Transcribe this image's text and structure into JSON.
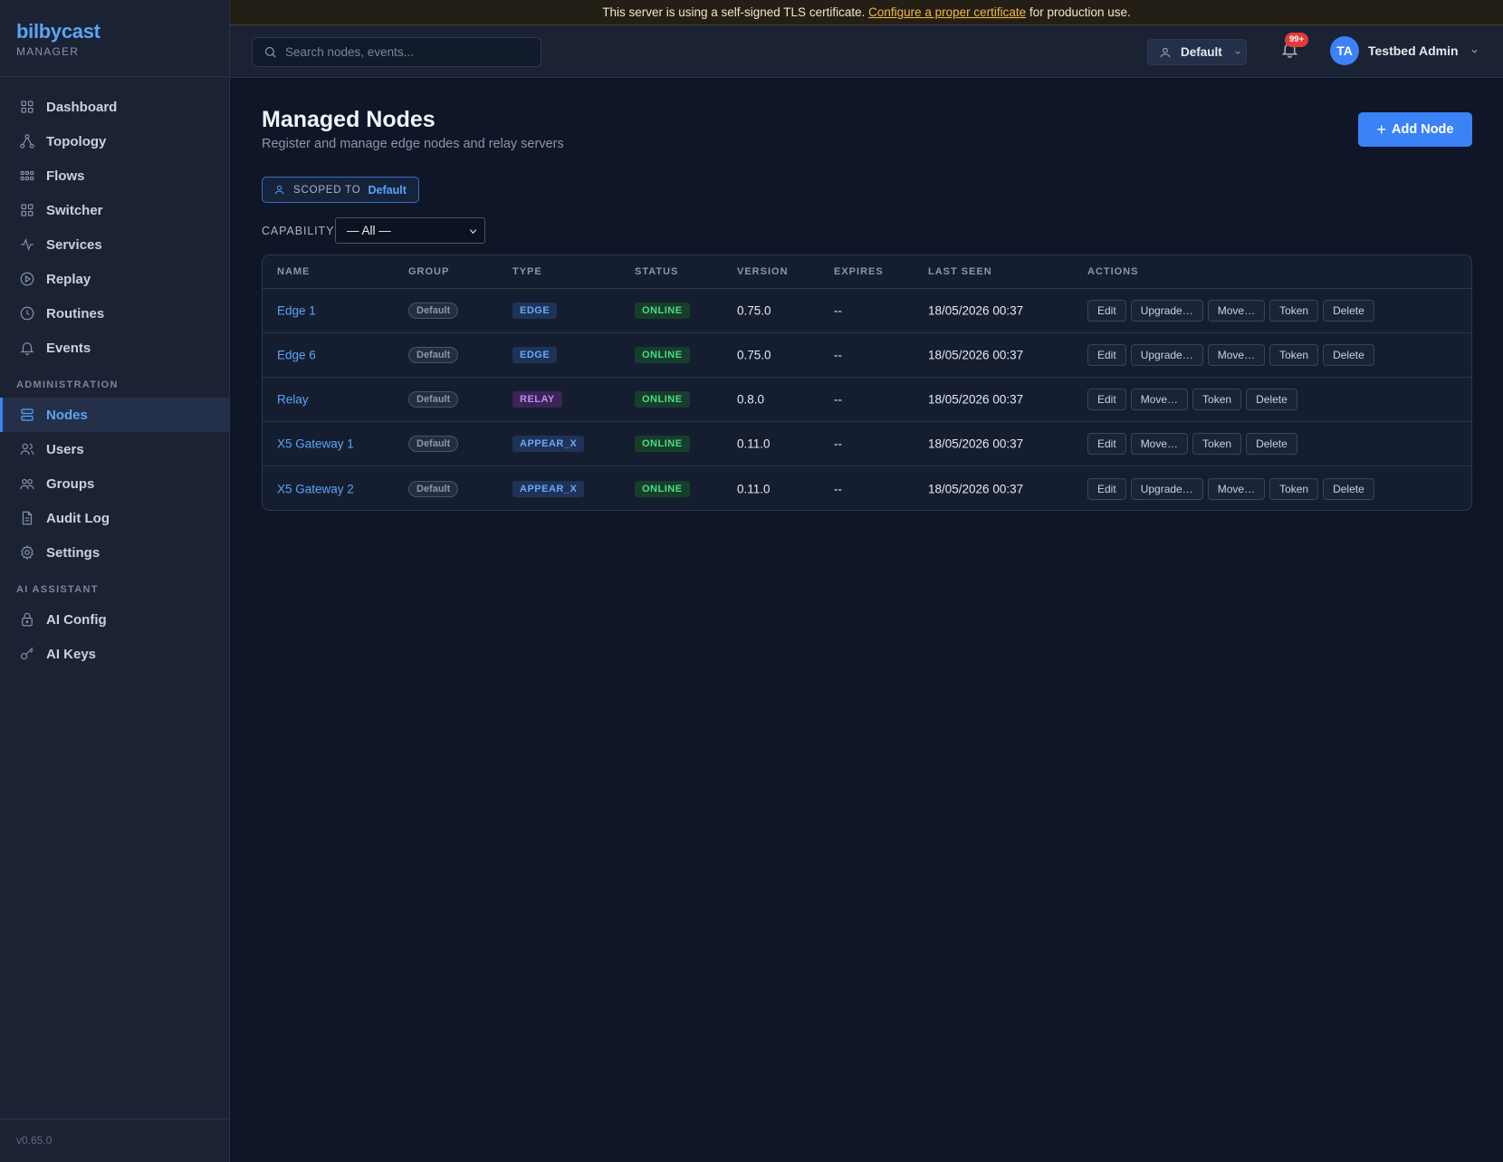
{
  "brand": {
    "name": "bilbycast",
    "sub": "MANAGER"
  },
  "banner": {
    "text_before": "This server is using a self-signed TLS certificate. ",
    "link": "Configure a proper certificate",
    "text_after": " for production use."
  },
  "search": {
    "placeholder": "Search nodes, events..."
  },
  "tenant": {
    "label": "Default"
  },
  "notifications": {
    "badge": "99+"
  },
  "user": {
    "initials": "TA",
    "name": "Testbed Admin"
  },
  "nav": {
    "items": [
      {
        "label": "Dashboard",
        "icon": "dashboard-icon"
      },
      {
        "label": "Topology",
        "icon": "topology-icon"
      },
      {
        "label": "Flows",
        "icon": "flows-icon"
      },
      {
        "label": "Switcher",
        "icon": "switcher-icon"
      },
      {
        "label": "Services",
        "icon": "activity-icon"
      },
      {
        "label": "Replay",
        "icon": "play-circle-icon"
      },
      {
        "label": "Routines",
        "icon": "clock-icon"
      },
      {
        "label": "Events",
        "icon": "bell-icon"
      }
    ],
    "admin_label": "ADMINISTRATION",
    "admin_items": [
      {
        "label": "Nodes",
        "icon": "server-icon",
        "active": true
      },
      {
        "label": "Users",
        "icon": "users-icon"
      },
      {
        "label": "Groups",
        "icon": "groups-icon"
      },
      {
        "label": "Audit Log",
        "icon": "file-icon"
      },
      {
        "label": "Settings",
        "icon": "gear-icon"
      }
    ],
    "ai_label": "AI ASSISTANT",
    "ai_items": [
      {
        "label": "AI Config",
        "icon": "lock-icon"
      },
      {
        "label": "AI Keys",
        "icon": "key-icon"
      }
    ]
  },
  "version": "v0.65.0",
  "page": {
    "title": "Managed Nodes",
    "subtitle": "Register and manage edge nodes and relay servers",
    "add_button": "Add Node",
    "scope_label": "SCOPED TO",
    "scope_value": "Default",
    "capability_label": "CAPABILITY",
    "capability_value": "— All —"
  },
  "table": {
    "headers": [
      "NAME",
      "GROUP",
      "TYPE",
      "STATUS",
      "VERSION",
      "EXPIRES",
      "LAST SEEN",
      "ACTIONS"
    ],
    "rows": [
      {
        "name": "Edge 1",
        "group": "Default",
        "type": "EDGE",
        "type_style": "edge",
        "status": "ONLINE",
        "version": "0.75.0",
        "expires": "--",
        "last_seen": "18/05/2026 00:37",
        "actions": [
          "Edit",
          "Upgrade…",
          "Move…",
          "Token",
          "Delete"
        ]
      },
      {
        "name": "Edge 6",
        "group": "Default",
        "type": "EDGE",
        "type_style": "edge",
        "status": "ONLINE",
        "version": "0.75.0",
        "expires": "--",
        "last_seen": "18/05/2026 00:37",
        "actions": [
          "Edit",
          "Upgrade…",
          "Move…",
          "Token",
          "Delete"
        ]
      },
      {
        "name": "Relay",
        "group": "Default",
        "type": "RELAY",
        "type_style": "relay",
        "status": "ONLINE",
        "version": "0.8.0",
        "expires": "--",
        "last_seen": "18/05/2026 00:37",
        "actions": [
          "Edit",
          "Move…",
          "Token",
          "Delete"
        ]
      },
      {
        "name": "X5 Gateway 1",
        "group": "Default",
        "type": "APPEAR_X",
        "type_style": "appear",
        "status": "ONLINE",
        "version": "0.11.0",
        "expires": "--",
        "last_seen": "18/05/2026 00:37",
        "actions": [
          "Edit",
          "Move…",
          "Token",
          "Delete"
        ]
      },
      {
        "name": "X5 Gateway 2",
        "group": "Default",
        "type": "APPEAR_X",
        "type_style": "appear",
        "status": "ONLINE",
        "version": "0.11.0",
        "expires": "--",
        "last_seen": "18/05/2026 00:37",
        "actions": [
          "Edit",
          "Upgrade…",
          "Move…",
          "Token",
          "Delete"
        ]
      }
    ]
  },
  "colors": {
    "accent": "#3b82f6",
    "link": "#5ba3f5",
    "online": "#4ade80",
    "relay": "#c08af0",
    "badge": "#e23b3b",
    "warning_link": "#f3b84a"
  }
}
